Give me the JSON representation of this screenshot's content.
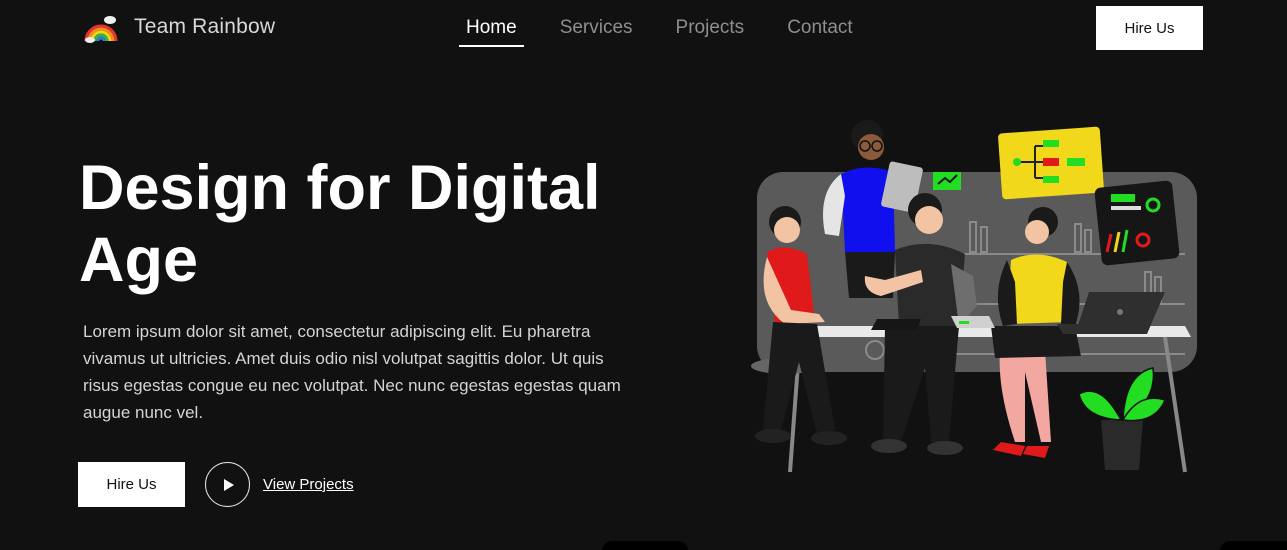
{
  "brand": {
    "name": "Team Rainbow",
    "logo_icon": "rainbow-icon"
  },
  "nav": {
    "items": [
      {
        "label": "Home",
        "active": true
      },
      {
        "label": "Services",
        "active": false
      },
      {
        "label": "Projects",
        "active": false
      },
      {
        "label": "Contact",
        "active": false
      }
    ],
    "cta_label": "Hire Us"
  },
  "hero": {
    "title": "Design for Digital Age",
    "description": "Lorem ipsum dolor sit amet, consectetur adipiscing elit. Eu pharetra vivamus ut ultricies. Amet duis odio nisl volutpat sagittis dolor. Ut quis risus egestas congue eu nec volutpat. Nec nunc egestas egestas quam augue nunc vel.",
    "primary_button": "Hire Us",
    "play_icon": "play-icon",
    "secondary_link": "View Projects"
  },
  "colors": {
    "background": "#111111",
    "accent_green": "#22dd22",
    "accent_yellow": "#f2d81a",
    "accent_blue": "#1010ee",
    "accent_red": "#e01a1a"
  }
}
